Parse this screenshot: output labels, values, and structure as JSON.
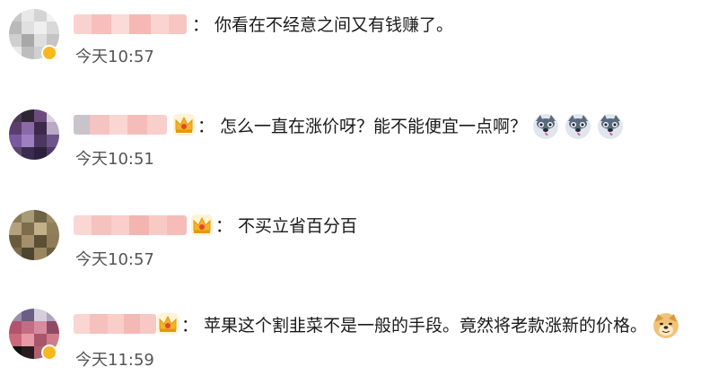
{
  "comments": [
    {
      "text": "你看在不经意之间又有钱赚了。",
      "time": "今天10:57",
      "has_crown": false,
      "emojis": []
    },
    {
      "text": "怎么一直在涨价呀？能不能便宜一点啊？",
      "time": "今天10:51",
      "has_crown": true,
      "emojis": [
        "husky-emoji",
        "husky-emoji",
        "husky-emoji"
      ]
    },
    {
      "text": "不买立省百分百",
      "time": "今天10:57",
      "has_crown": true,
      "emojis": []
    },
    {
      "text": "苹果这个割韭菜不是一般的手段。竟然将老款涨新的价格。",
      "time": "今天11:59",
      "has_crown": true,
      "emojis": [
        "doge-emoji"
      ]
    }
  ],
  "colon": "：",
  "colors": {
    "crown_gold": "#f4b323",
    "crown_red": "#e5443a",
    "name_blur": "#f7c3c0",
    "vip_badge": "#f6b81d"
  }
}
